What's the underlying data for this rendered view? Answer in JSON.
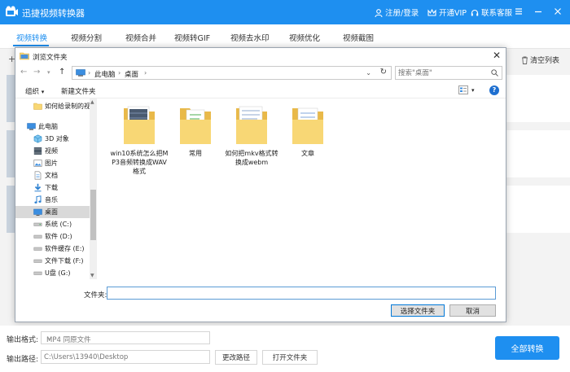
{
  "app": {
    "title": "迅捷视频转换器",
    "login": "注册/登录",
    "vip": "开通VIP",
    "support": "联系客服"
  },
  "tabs": [
    {
      "label": "视频转换",
      "active": true
    },
    {
      "label": "视频分割"
    },
    {
      "label": "视频合并"
    },
    {
      "label": "视频转GIF"
    },
    {
      "label": "视频去水印"
    },
    {
      "label": "视频优化"
    },
    {
      "label": "视频截图"
    }
  ],
  "toolbar": {
    "clear_list": "清空列表"
  },
  "dialog": {
    "title": "浏览文件夹",
    "breadcrumb": [
      "此电脑",
      "桌面"
    ],
    "search_placeholder": "搜索\"桌面\"",
    "organize": "组织",
    "new_folder": "新建文件夹",
    "help": "?",
    "nav_items": [
      {
        "label": "如何给录制的视",
        "icon": "folder-icon"
      },
      {
        "label": "此电脑",
        "icon": "computer-icon"
      },
      {
        "label": "3D 对象",
        "icon": "3d-objects-icon"
      },
      {
        "label": "视频",
        "icon": "video-icon"
      },
      {
        "label": "图片",
        "icon": "picture-icon"
      },
      {
        "label": "文档",
        "icon": "document-icon"
      },
      {
        "label": "下载",
        "icon": "download-icon"
      },
      {
        "label": "音乐",
        "icon": "music-icon"
      },
      {
        "label": "桌面",
        "icon": "desktop-icon",
        "selected": true
      },
      {
        "label": "系统 (C:)",
        "icon": "drive-icon"
      },
      {
        "label": "软件 (D:)",
        "icon": "drive-icon"
      },
      {
        "label": "软件缓存 (E:)",
        "icon": "drive-icon"
      },
      {
        "label": "文件下载 (F:)",
        "icon": "drive-icon"
      },
      {
        "label": "U盘 (G:)",
        "icon": "drive-icon"
      }
    ],
    "folders": [
      {
        "label": "win10系统怎么把MP3音频转换成WAV格式"
      },
      {
        "label": "常用"
      },
      {
        "label": "如何把mkv格式转换成webm"
      },
      {
        "label": "文章"
      }
    ],
    "filename_label": "文件夹:",
    "filename_value": "",
    "select_button": "选择文件夹",
    "cancel_button": "取消"
  },
  "footer": {
    "format_label": "输出格式:",
    "format_value": "MP4  同原文件",
    "path_label": "输出路径:",
    "path_value": "C:\\Users\\13940\\Desktop",
    "change_path": "更改路径",
    "open_folder": "打开文件夹",
    "convert_all": "全部转换"
  },
  "colors": {
    "brand": "#1e8ff0",
    "folder": "#f8d775",
    "selected_row": "#d9d9d9"
  }
}
